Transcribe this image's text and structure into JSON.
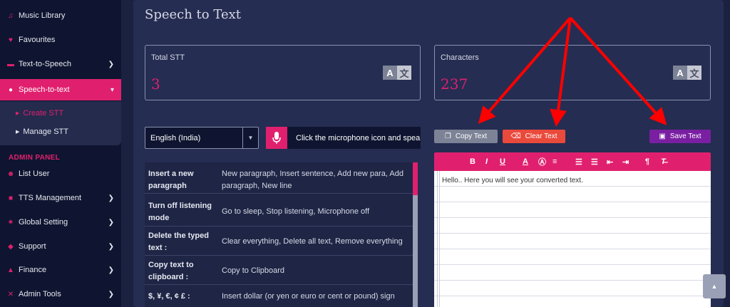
{
  "sidebar": {
    "items": [
      {
        "label": "Music Library",
        "icon": "music-icon"
      },
      {
        "label": "Favourites",
        "icon": "heart-icon"
      },
      {
        "label": "Text-to-Speech",
        "icon": "message-icon"
      },
      {
        "label": "Speech-to-text",
        "icon": "mic-icon"
      }
    ],
    "sub_items": [
      {
        "label": "Create STT"
      },
      {
        "label": "Manage STT"
      }
    ],
    "admin_label": "ADMIN PANEL",
    "admin_items": [
      {
        "label": "List User",
        "icon": "users-icon"
      },
      {
        "label": "TTS Management",
        "icon": "tree-icon"
      },
      {
        "label": "Global Setting",
        "icon": "gear-icon"
      },
      {
        "label": "Support",
        "icon": "tag-icon"
      },
      {
        "label": "Finance",
        "icon": "piggy-bank-icon"
      },
      {
        "label": "Admin Tools",
        "icon": "tools-icon"
      }
    ]
  },
  "page": {
    "title": "Speech to Text"
  },
  "stats": {
    "total_label": "Total STT",
    "total_value": "3",
    "chars_label": "Characters",
    "chars_value": "237"
  },
  "language": {
    "selected": "English (India)"
  },
  "mic_hint": "Click the microphone icon and speak",
  "commands": [
    {
      "key": "Insert a new paragraph",
      "value": "New paragraph, Insert sentence, Add new para, Add paragraph, New line"
    },
    {
      "key": "Turn off listening mode",
      "value": "Go to sleep, Stop listening, Microphone off"
    },
    {
      "key": "Delete the typed text :",
      "value": "Clear everything, Delete all text, Remove everything"
    },
    {
      "key": "Copy text to clipboard :",
      "value": "Copy to Clipboard"
    },
    {
      "key": "$, ¥, €, ¢ £ :",
      "value": "Insert dollar (or yen or euro or cent or pound) sign"
    }
  ],
  "actions": {
    "copy_label": "Copy Text",
    "clear_label": "Clear Text",
    "save_label": "Save Text"
  },
  "editor": {
    "content": "Hello.. Here you will see your converted text."
  },
  "colors": {
    "accent": "#e0206e",
    "sidebar_bg": "#0f1530",
    "main_bg": "#252d52",
    "annotation": "#ff0000"
  }
}
